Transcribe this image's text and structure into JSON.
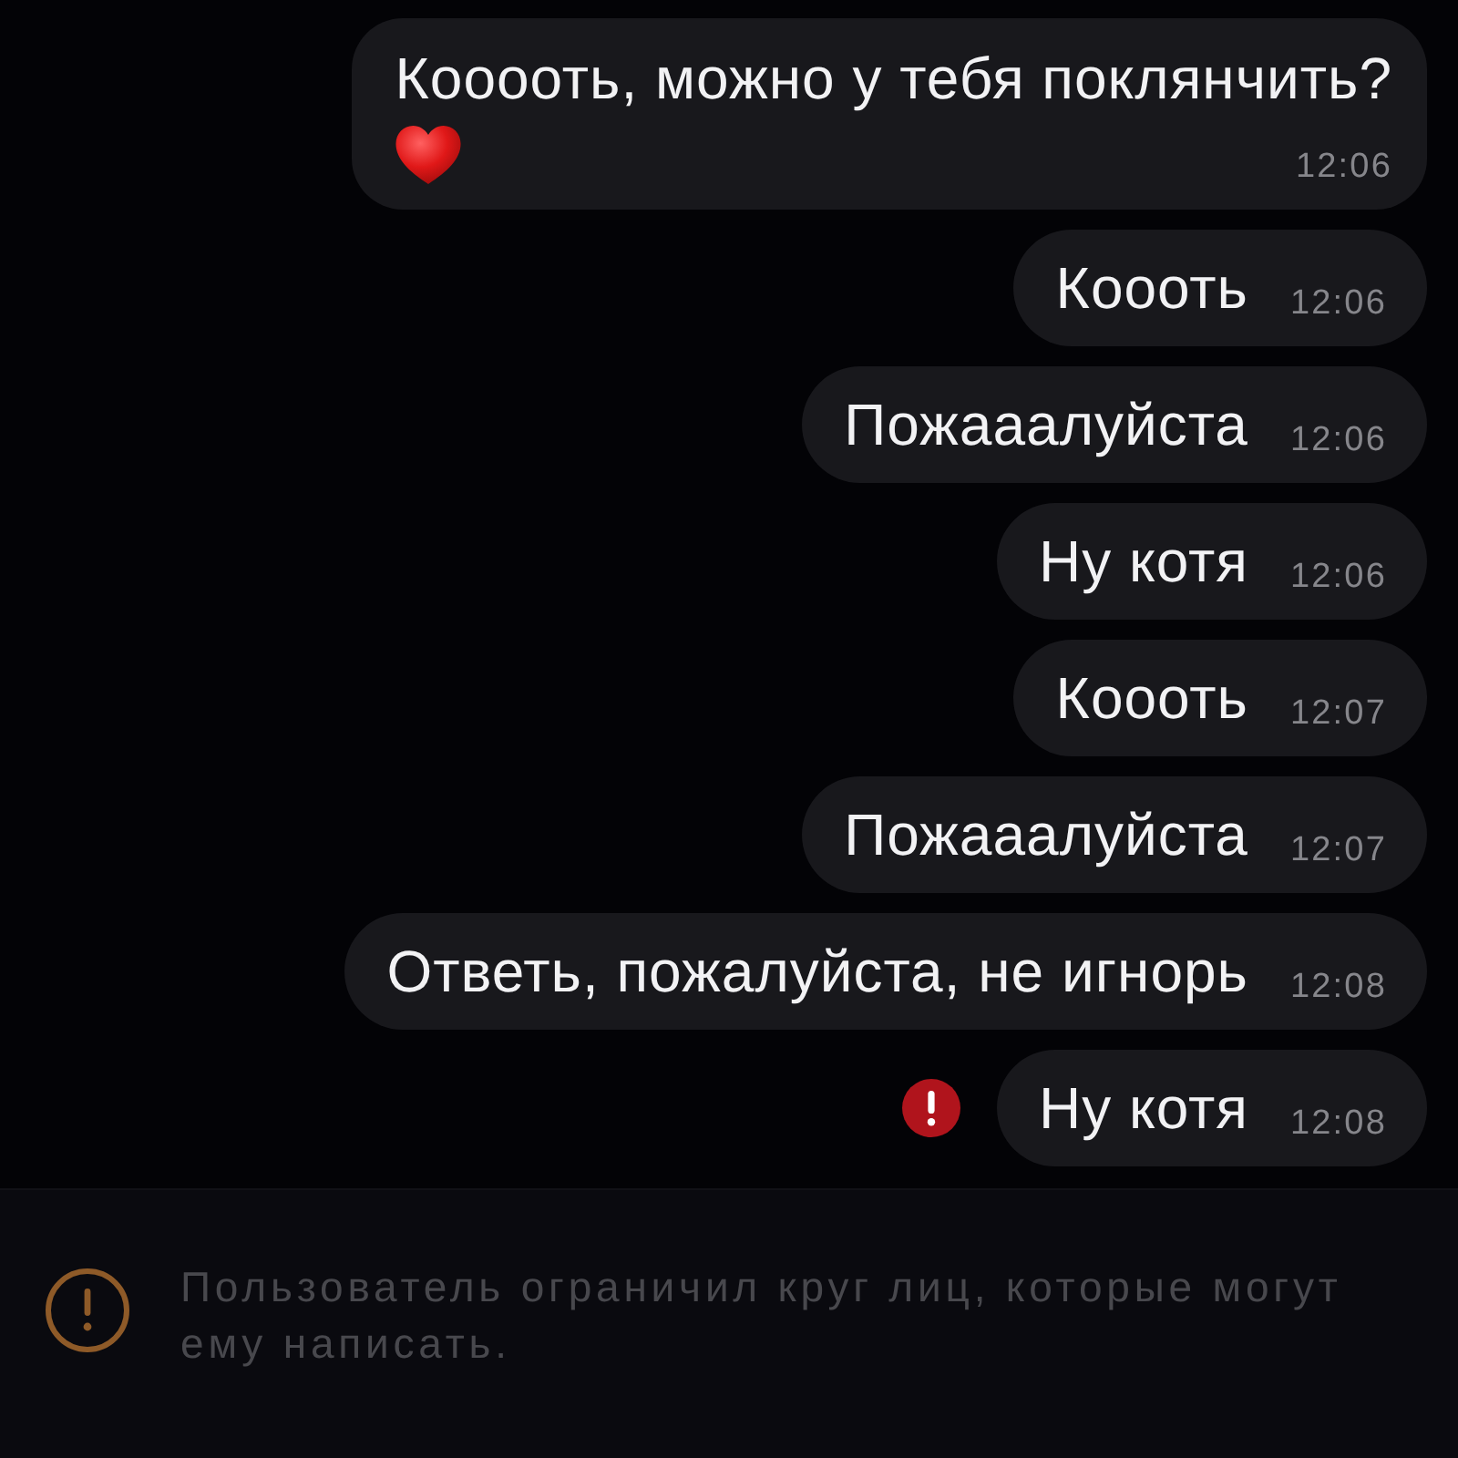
{
  "messages": [
    {
      "text": "Кооооть, можно у тебя поклянчить?",
      "time": "12:06",
      "has_emoji": true,
      "failed": false
    },
    {
      "text": "Коооть",
      "time": "12:06",
      "has_emoji": false,
      "failed": false
    },
    {
      "text": "Пожааалуйста",
      "time": "12:06",
      "has_emoji": false,
      "failed": false
    },
    {
      "text": "Ну котя",
      "time": "12:06",
      "has_emoji": false,
      "failed": false
    },
    {
      "text": "Коооть",
      "time": "12:07",
      "has_emoji": false,
      "failed": false
    },
    {
      "text": "Пожааалуйста",
      "time": "12:07",
      "has_emoji": false,
      "failed": false
    },
    {
      "text": "Ответь, пожалуйста, не игнорь",
      "time": "12:08",
      "has_emoji": false,
      "failed": false
    },
    {
      "text": "Ну котя",
      "time": "12:08",
      "has_emoji": false,
      "failed": true
    }
  ],
  "notice": {
    "text": "Пользователь ограничил круг лиц, которые могут ему написать."
  }
}
